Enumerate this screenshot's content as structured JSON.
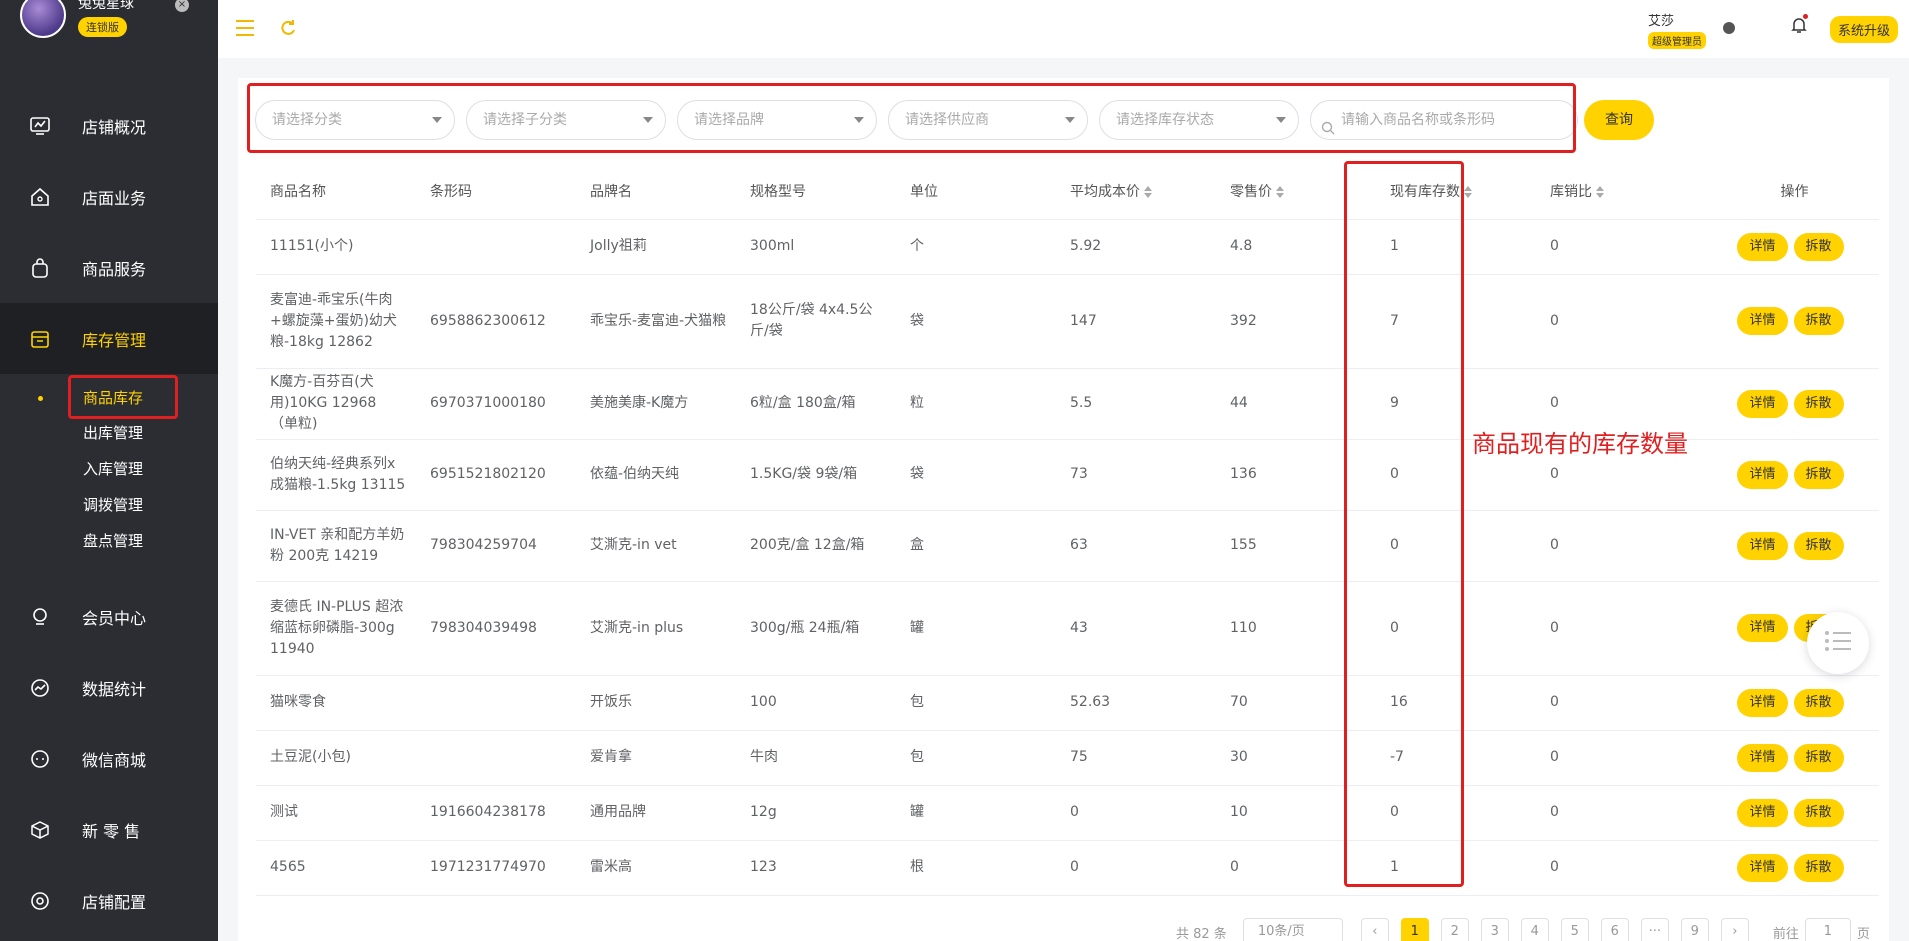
{
  "sidebar": {
    "brand_name": "兔兔星球",
    "brand_badge": "连锁版",
    "menu": [
      {
        "label": "店铺概况",
        "icon": "monitor-icon"
      },
      {
        "label": "店面业务",
        "icon": "home-icon"
      },
      {
        "label": "商品服务",
        "icon": "bag-icon"
      },
      {
        "label": "库存管理",
        "icon": "box-icon"
      },
      {
        "label": "会员中心",
        "icon": "member-icon"
      },
      {
        "label": "数据统计",
        "icon": "chart-icon"
      },
      {
        "label": "微信商城",
        "icon": "wechat-icon"
      },
      {
        "label": "新 零 售",
        "icon": "cube-icon"
      },
      {
        "label": "店铺配置",
        "icon": "settings-icon"
      }
    ],
    "submenu": [
      "商品库存",
      "出库管理",
      "入库管理",
      "调拨管理",
      "盘点管理"
    ]
  },
  "topbar": {
    "user_name": "艾莎",
    "user_role": "超级管理员",
    "upgrade": "系统升级"
  },
  "filters": {
    "category": "请选择分类",
    "subcategory": "请选择子分类",
    "brand": "请选择品牌",
    "supplier": "请选择供应商",
    "stock_status": "请选择库存状态",
    "search_placeholder": "请输入商品名称或条形码",
    "query": "查询"
  },
  "table": {
    "headers": [
      "商品名称",
      "条形码",
      "品牌名",
      "规格型号",
      "单位",
      "平均成本价",
      "零售价",
      "现有库存数",
      "库销比",
      "操作"
    ],
    "detail_label": "详情",
    "split_label": "拆散",
    "rows": [
      {
        "name": "11151(小个)",
        "barcode": "",
        "brand": "Jolly祖莉",
        "spec": "300ml",
        "unit": "个",
        "cost": "5.92",
        "price": "4.8",
        "stock": "1",
        "ratio": "0"
      },
      {
        "name": "麦富迪-乖宝乐(牛肉+螺旋藻+蛋奶)幼犬粮-18kg 12862",
        "barcode": "6958862300612",
        "brand": "乖宝乐-麦富迪-犬猫粮",
        "spec": "18公斤/袋 4x4.5公斤/袋",
        "unit": "袋",
        "cost": "147",
        "price": "392",
        "stock": "7",
        "ratio": "0"
      },
      {
        "name": "K魔方-百芬百(犬用)10KG 12968 （单粒)",
        "barcode": "6970371000180",
        "brand": "美施美康-K魔方",
        "spec": "6粒/盒 180盒/箱",
        "unit": "粒",
        "cost": "5.5",
        "price": "44",
        "stock": "9",
        "ratio": "0"
      },
      {
        "name": "伯纳天纯-经典系列x成猫粮-1.5kg 13115",
        "barcode": "6951521802120",
        "brand": "依蕴-伯纳天纯",
        "spec": "1.5KG/袋 9袋/箱",
        "unit": "袋",
        "cost": "73",
        "price": "136",
        "stock": "0",
        "ratio": "0"
      },
      {
        "name": "IN-VET 亲和配方羊奶粉 200克 14219",
        "barcode": "798304259704",
        "brand": "艾澌克-in vet",
        "spec": "200克/盒 12盒/箱",
        "unit": "盒",
        "cost": "63",
        "price": "155",
        "stock": "0",
        "ratio": "0"
      },
      {
        "name": "麦德氏 IN-PLUS 超浓缩蓝标卵磷脂-300g 11940",
        "barcode": "798304039498",
        "brand": "艾澌克-in plus",
        "spec": "300g/瓶 24瓶/箱",
        "unit": "罐",
        "cost": "43",
        "price": "110",
        "stock": "0",
        "ratio": "0"
      },
      {
        "name": "猫咪零食",
        "barcode": "",
        "brand": "开饭乐",
        "spec": "100",
        "unit": "包",
        "cost": "52.63",
        "price": "70",
        "stock": "16",
        "ratio": "0"
      },
      {
        "name": "土豆泥(小包)",
        "barcode": "",
        "brand": "爱肯拿",
        "spec": "牛肉",
        "unit": "包",
        "cost": "75",
        "price": "30",
        "stock": "-7",
        "ratio": "0"
      },
      {
        "name": "测试",
        "barcode": "1916604238178",
        "brand": "通用品牌",
        "spec": "12g",
        "unit": "罐",
        "cost": "0",
        "price": "10",
        "stock": "0",
        "ratio": "0"
      },
      {
        "name": "4565",
        "barcode": "1971231774970",
        "brand": "雷米高",
        "spec": "123",
        "unit": "根",
        "cost": "0",
        "price": "0",
        "stock": "1",
        "ratio": "0"
      }
    ]
  },
  "annotation": "商品现有的库存数量",
  "pager": {
    "total": "共 82 条",
    "size": "10条/页",
    "pages": [
      "1",
      "2",
      "3",
      "4",
      "5",
      "6",
      "···",
      "9"
    ],
    "goto_label": "前往",
    "goto_value": "1",
    "page_suffix": "页"
  },
  "colors": {
    "accent": "#ffd200",
    "sidebar": "#2b2d33",
    "annotation": "#e02020"
  }
}
